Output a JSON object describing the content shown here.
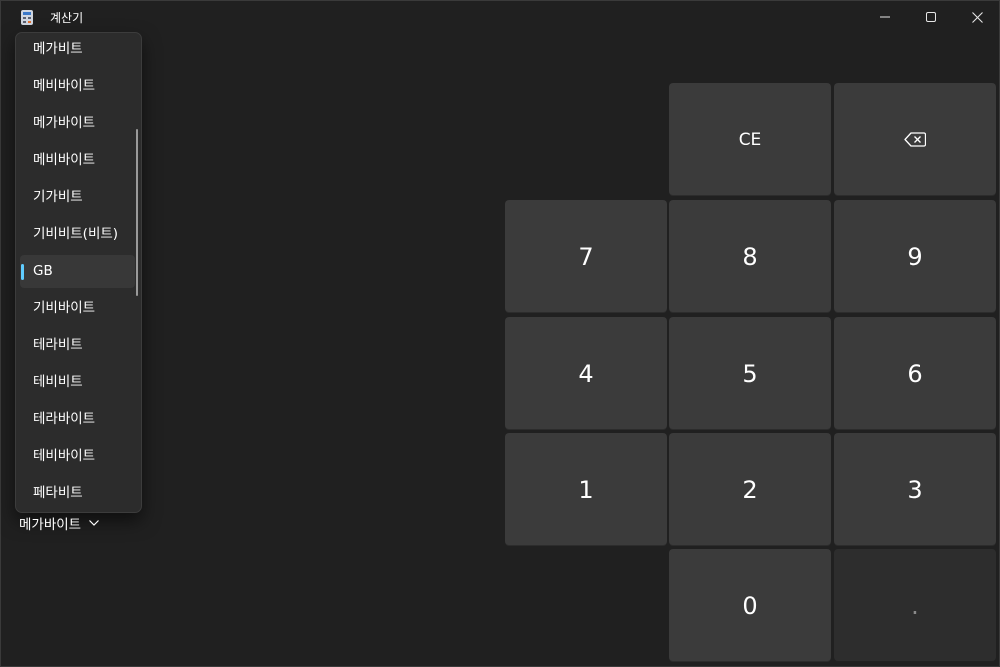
{
  "window": {
    "title": "계산기",
    "controls": {
      "minimize_icon": "minimize-icon",
      "maximize_icon": "maximize-icon",
      "close_icon": "close-icon"
    }
  },
  "dropdown": {
    "items": [
      {
        "label": "메가비트"
      },
      {
        "label": "메비바이트"
      },
      {
        "label": "메가바이트"
      },
      {
        "label": "메비바이트"
      },
      {
        "label": "기가비트"
      },
      {
        "label": "기비비트(비트)"
      },
      {
        "label": "GB",
        "selected": true
      },
      {
        "label": "기비바이트"
      },
      {
        "label": "테라비트"
      },
      {
        "label": "테비비트"
      },
      {
        "label": "테라바이트"
      },
      {
        "label": "테비바이트"
      },
      {
        "label": "페타비트"
      }
    ],
    "accent_color": "#60cdff"
  },
  "unit_selector": {
    "value": "메가바이트",
    "icon": "chevron-down-icon"
  },
  "keypad": {
    "ce": "CE",
    "backspace_icon": "backspace-icon",
    "k7": "7",
    "k8": "8",
    "k9": "9",
    "k4": "4",
    "k5": "5",
    "k6": "6",
    "k1": "1",
    "k2": "2",
    "k3": "3",
    "k0": "0",
    "decimal": "."
  },
  "colors": {
    "background": "#202020",
    "key": "#3b3b3b",
    "key_disabled": "#2d2d2d",
    "menu": "#2c2c2c"
  }
}
